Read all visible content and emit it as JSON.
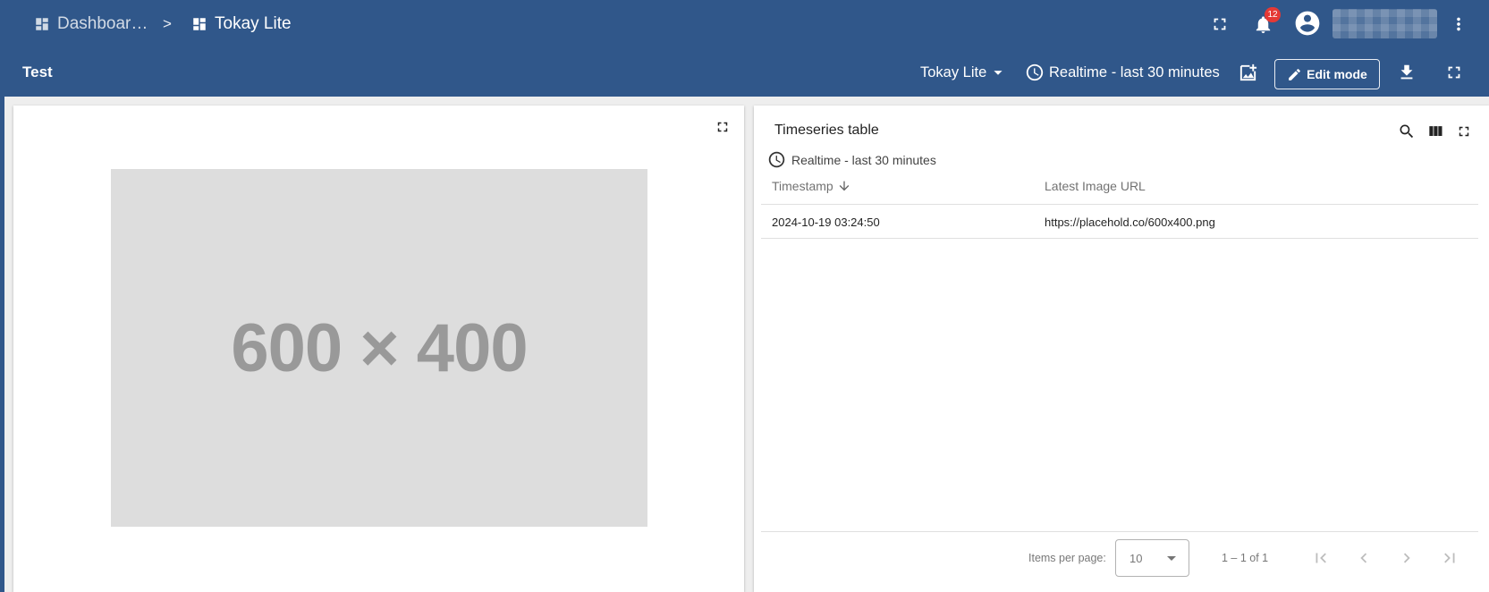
{
  "header": {
    "breadcrumbs": [
      {
        "label": "Dashboar…",
        "icon": "dashboard-icon"
      },
      {
        "label": "Tokay Lite",
        "icon": "dashboard-icon"
      }
    ],
    "separator": ">",
    "notifications_count": "12"
  },
  "toolbar": {
    "dashboard_title": "Test",
    "state_label": "Tokay Lite",
    "time_window_label": "Realtime - last 30 minutes",
    "edit_label": "Edit mode"
  },
  "image_widget": {
    "placeholder_text": "600 × 400"
  },
  "table_widget": {
    "title": "Timeseries table",
    "time_window": "Realtime - last 30 minutes",
    "columns": [
      "Timestamp",
      "Latest Image URL"
    ],
    "rows": [
      [
        "2024-10-19 03:24:50",
        "https://placehold.co/600x400.png"
      ]
    ],
    "pagination": {
      "items_per_page_label": "Items per page:",
      "items_per_page_value": "10",
      "range_label": "1 – 1 of 1"
    }
  },
  "colors": {
    "primary": "#30578a",
    "badge": "#e53935",
    "canvas_bg": "#eeeeee"
  }
}
